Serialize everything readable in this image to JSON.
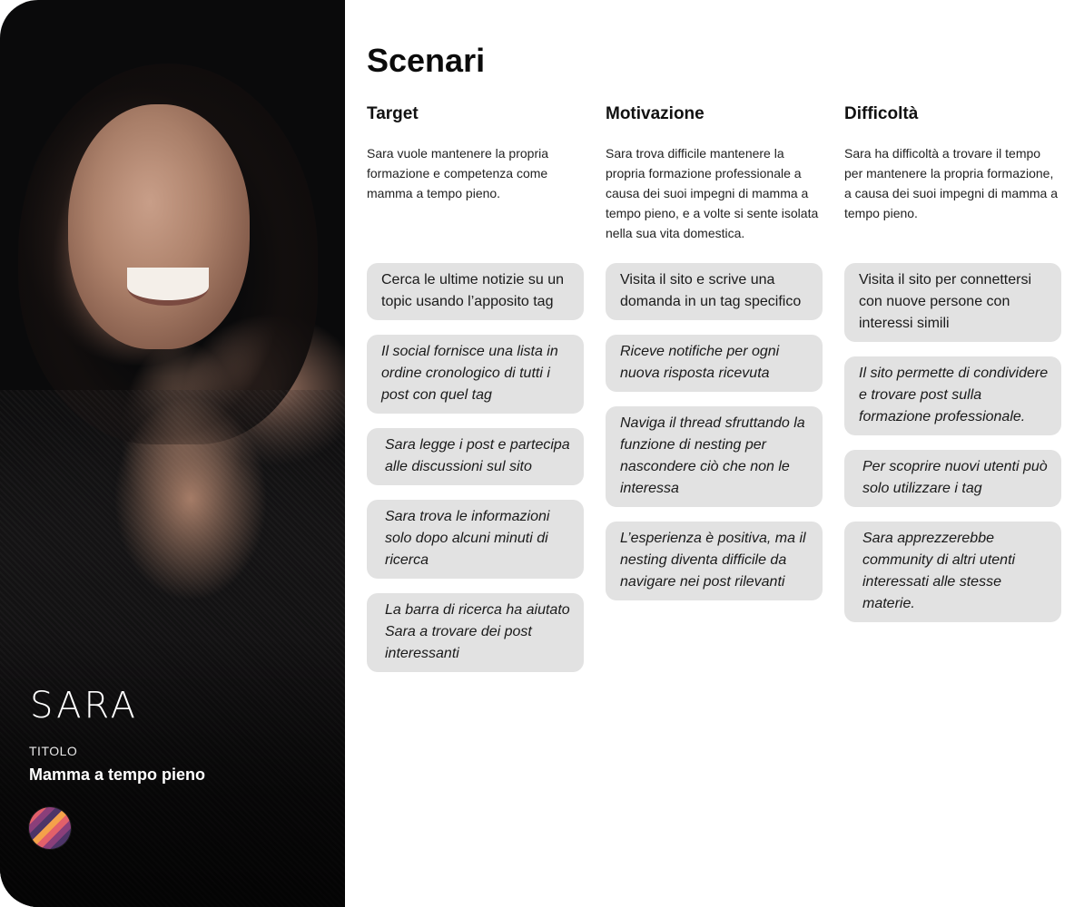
{
  "profile": {
    "name": "SARA",
    "title_label": "TITOLO",
    "title_value": "Mamma a tempo pieno"
  },
  "page": {
    "heading": "Scenari"
  },
  "columns": [
    {
      "title": "Target",
      "description": "Sara vuole mantenere la propria formazione e competenza come mamma a tempo pieno.",
      "cards": [
        "Cerca le ultime notizie su un topic usando l’apposito tag",
        "Il social fornisce una lista in ordine cronologico di tutti i post con quel tag",
        "Sara legge i post e partecipa alle discussioni sul sito",
        "Sara trova le informazioni solo dopo alcuni minuti di ricerca",
        "La barra di ricerca ha aiutato Sara a trovare dei post interessanti"
      ]
    },
    {
      "title": "Motivazione",
      "description": "Sara trova difficile mantenere la propria formazione professionale a causa dei suoi impegni di mamma a tempo pieno, e a volte si sente isolata nella sua vita domestica.",
      "cards": [
        "Visita il sito e scrive una domanda in un tag specifico",
        "Riceve notifiche per ogni nuova risposta ricevuta",
        "Naviga il thread sfruttando la funzione di nesting per nascondere ciò che non le interessa",
        "L’esperienza è positiva, ma il nesting diventa difficile da navigare nei post rilevanti"
      ]
    },
    {
      "title": "Difficoltà",
      "description": "Sara ha difficoltà a trovare il tempo per mantenere la propria formazione, a causa dei suoi impegni di mamma a tempo pieno.",
      "cards": [
        "Visita il sito per connettersi con nuove persone con interessi simili",
        "Il sito permette di condividere e trovare post sulla formazione professionale.",
        "Per scoprire nuovi utenti può solo utilizzare i tag",
        "Sara apprezzerebbe community di altri utenti interessati alle stesse materie."
      ]
    }
  ]
}
